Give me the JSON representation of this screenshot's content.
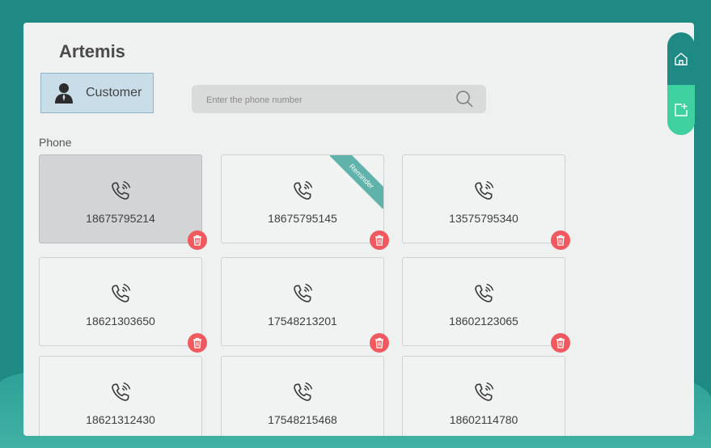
{
  "app": {
    "title": "Artemis"
  },
  "customer_button": {
    "label": "Customer",
    "icon": "person-icon"
  },
  "search": {
    "placeholder": "Enter the phone number",
    "value": "",
    "icon": "search-icon"
  },
  "section": {
    "label": "Phone"
  },
  "ribbon": {
    "label": "Reminder",
    "color": "#5fb3ab"
  },
  "colors": {
    "accent": "#1f8a83",
    "add": "#3fd0a0",
    "delete": "#f05a5f"
  },
  "cards": [
    {
      "number": "18675795214",
      "selected": true,
      "reminder": false
    },
    {
      "number": "18675795145",
      "selected": false,
      "reminder": true
    },
    {
      "number": "13575795340",
      "selected": false,
      "reminder": false
    },
    {
      "number": "18621303650",
      "selected": false,
      "reminder": false
    },
    {
      "number": "17548213201",
      "selected": false,
      "reminder": false
    },
    {
      "number": "18602123065",
      "selected": false,
      "reminder": false
    },
    {
      "number": "18621312430",
      "selected": false,
      "reminder": false
    },
    {
      "number": "17548215468",
      "selected": false,
      "reminder": false
    },
    {
      "number": "18602114780",
      "selected": false,
      "reminder": false
    }
  ],
  "side_rail": {
    "home_icon": "home-icon",
    "add_icon": "add-page-icon"
  }
}
